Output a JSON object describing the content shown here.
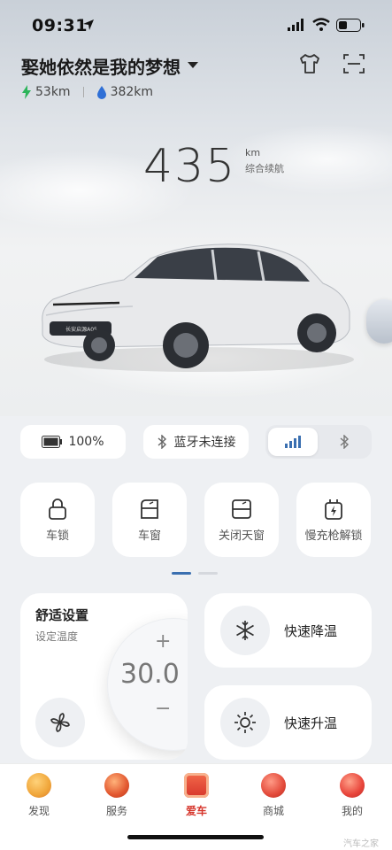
{
  "status_bar": {
    "time": "09:31"
  },
  "header": {
    "title": "娶她依然是我的梦想",
    "electric_range": "53km",
    "fuel_range": "382km"
  },
  "hero": {
    "total_range_value": "435",
    "total_range_unit": "km",
    "total_range_label": "综合续航",
    "car_plate_text": "长安启源A05"
  },
  "status_pills": {
    "battery_percent": "100%",
    "bluetooth_status": "蓝牙未连接"
  },
  "controls": [
    {
      "label": "车锁",
      "icon": "lock-icon"
    },
    {
      "label": "车窗",
      "icon": "window-icon"
    },
    {
      "label": "关闭天窗",
      "icon": "sunroof-icon"
    },
    {
      "label": "慢充枪解锁",
      "icon": "charger-icon"
    }
  ],
  "comfort": {
    "title": "舒适设置",
    "subtitle": "设定温度",
    "temperature": "30.0",
    "plus": "+",
    "minus": "−"
  },
  "quick_actions": {
    "cool_label": "快速降温",
    "heat_label": "快速升温"
  },
  "tabs": [
    {
      "label": "发现",
      "color": "#f0a63a"
    },
    {
      "label": "服务",
      "color": "#e2572f"
    },
    {
      "label": "爱车",
      "color": "#d6352b",
      "active": true
    },
    {
      "label": "商城",
      "color": "#e34a3a"
    },
    {
      "label": "我的",
      "color": "#e8443a"
    }
  ],
  "watermark": "汽车之家",
  "colors": {
    "accent": "#3a6fb0",
    "active_tab": "#d6352b",
    "electric": "#2cb45a",
    "fuel": "#2f6fd6"
  }
}
